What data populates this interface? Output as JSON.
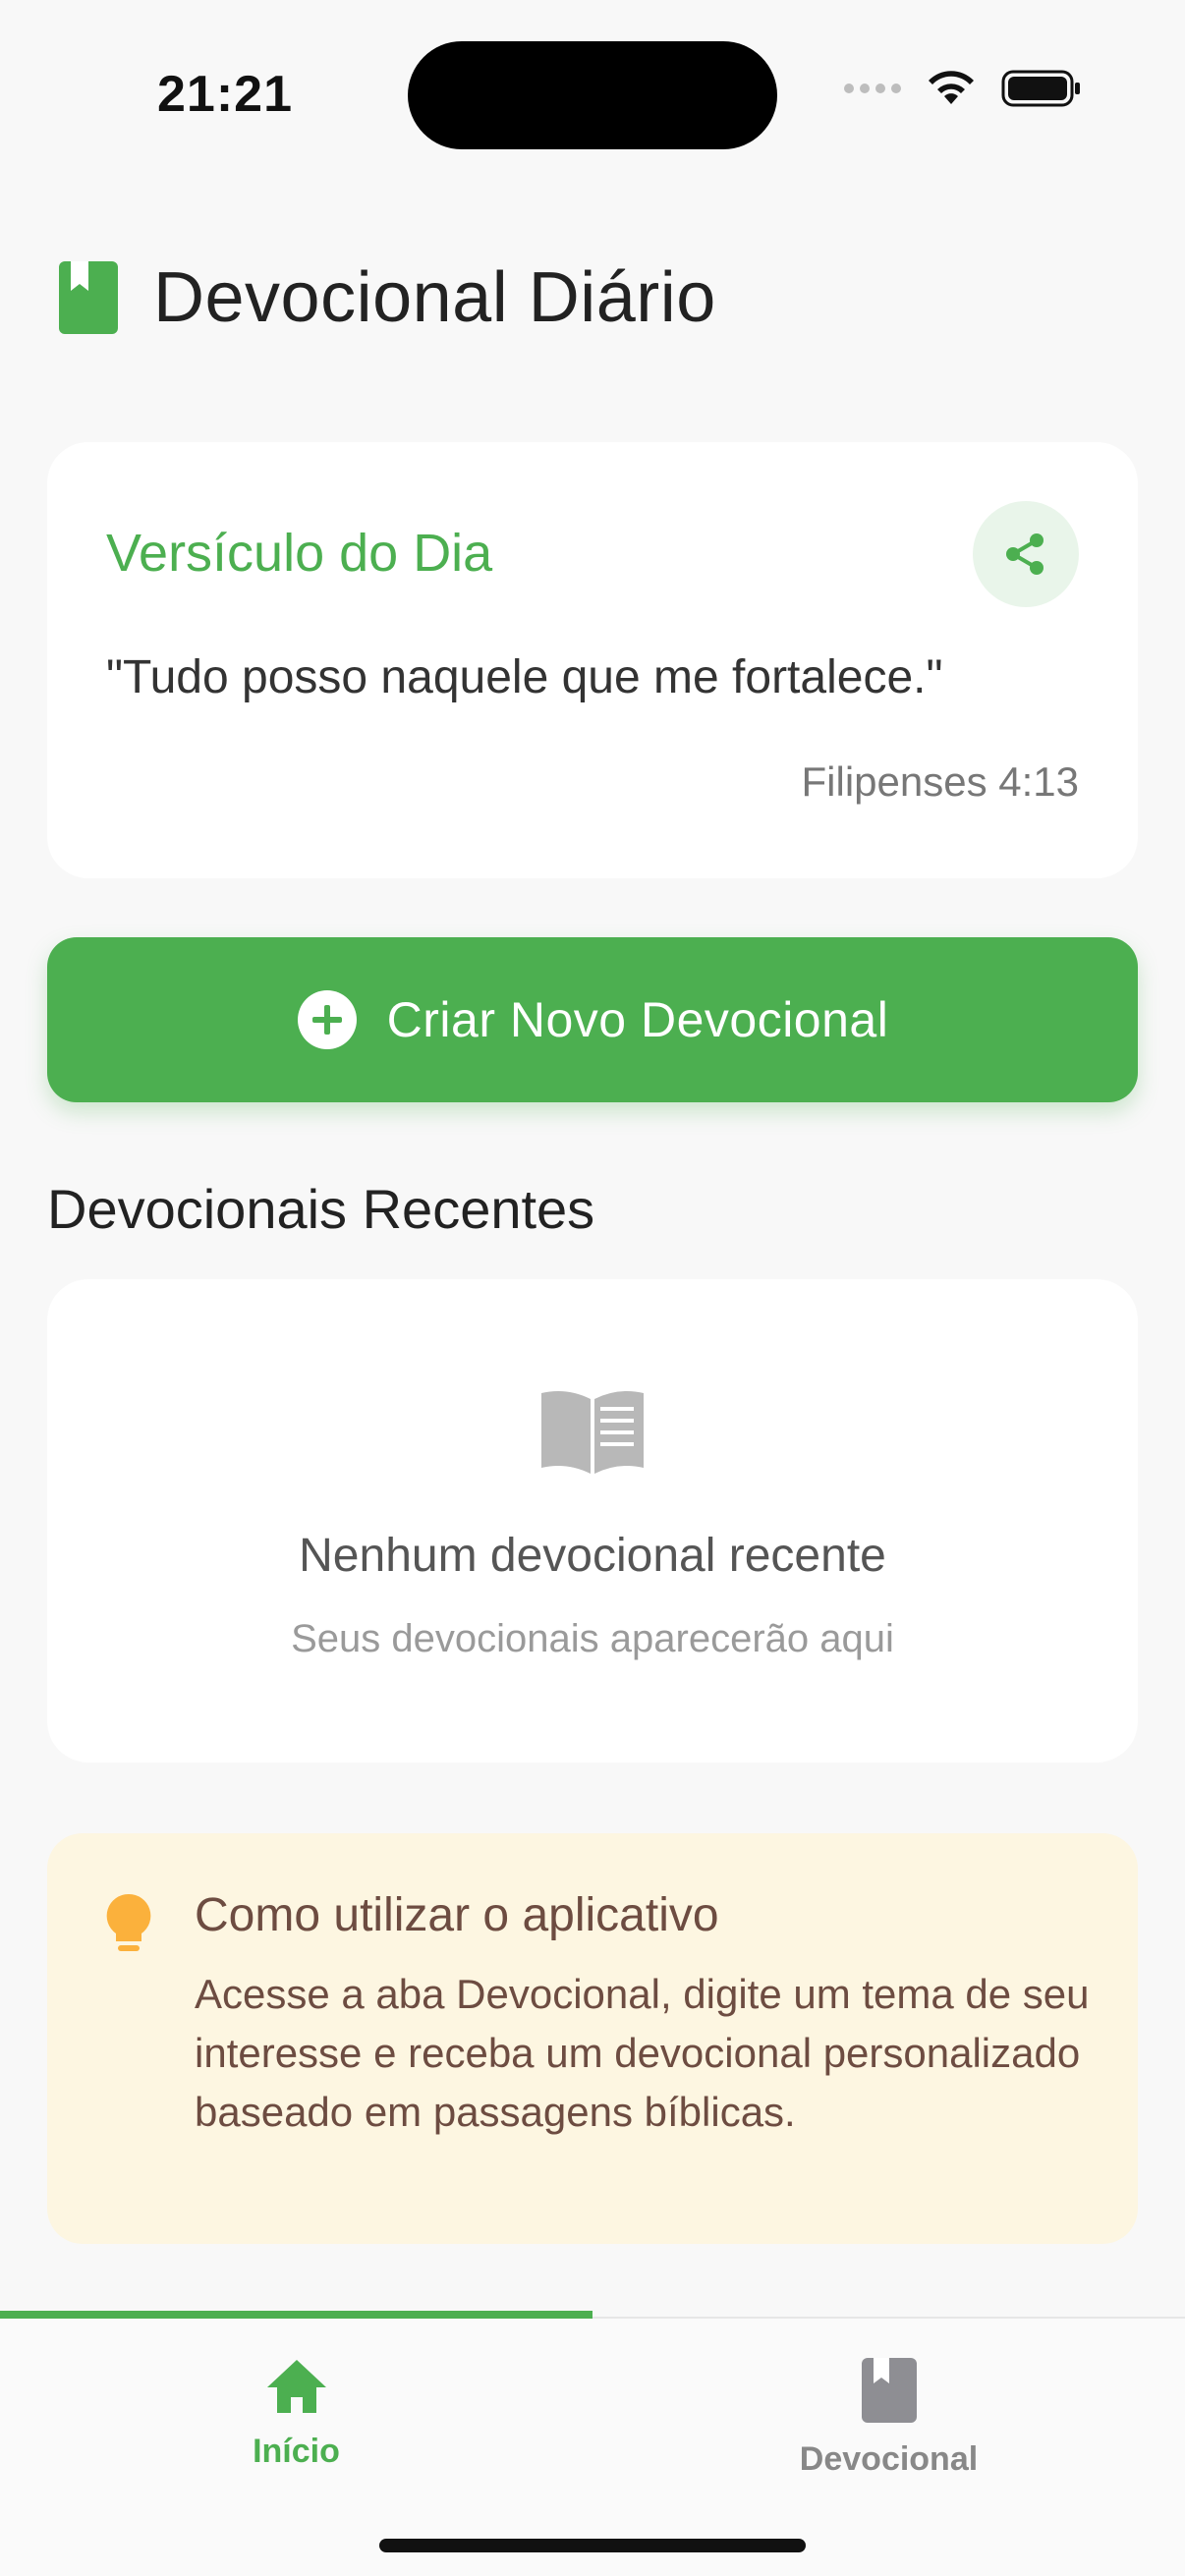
{
  "status_bar": {
    "time": "21:21"
  },
  "header": {
    "title": "Devocional Diário",
    "icon": "book-icon"
  },
  "verse_card": {
    "title": "Versículo do Dia",
    "text": "\"Tudo posso naquele que me fortalece.\"",
    "reference": "Filipenses 4:13",
    "share_icon": "share-icon"
  },
  "create_button": {
    "label": "Criar Novo Devocional",
    "icon": "plus-circle-icon"
  },
  "recent": {
    "title": "Devocionais Recentes",
    "empty_title": "Nenhum devocional recente",
    "empty_subtitle": "Seus devocionais aparecerão aqui",
    "empty_icon": "open-book-icon"
  },
  "tip": {
    "title": "Como utilizar o aplicativo",
    "body": "Acesse a aba Devocional, digite um tema de seu interesse e receba um devocional personalizado baseado em passagens bíblicas.",
    "icon": "lightbulb-icon"
  },
  "bottom_nav": {
    "items": [
      {
        "label": "Início",
        "icon": "home-icon",
        "active": true
      },
      {
        "label": "Devocional",
        "icon": "book-icon",
        "active": false
      }
    ]
  },
  "colors": {
    "accent": "#4caf50",
    "background": "#f8f8f8",
    "tip_background": "#fdf6e1",
    "tip_text": "#6d4c41",
    "tip_icon": "#fbb13c"
  }
}
